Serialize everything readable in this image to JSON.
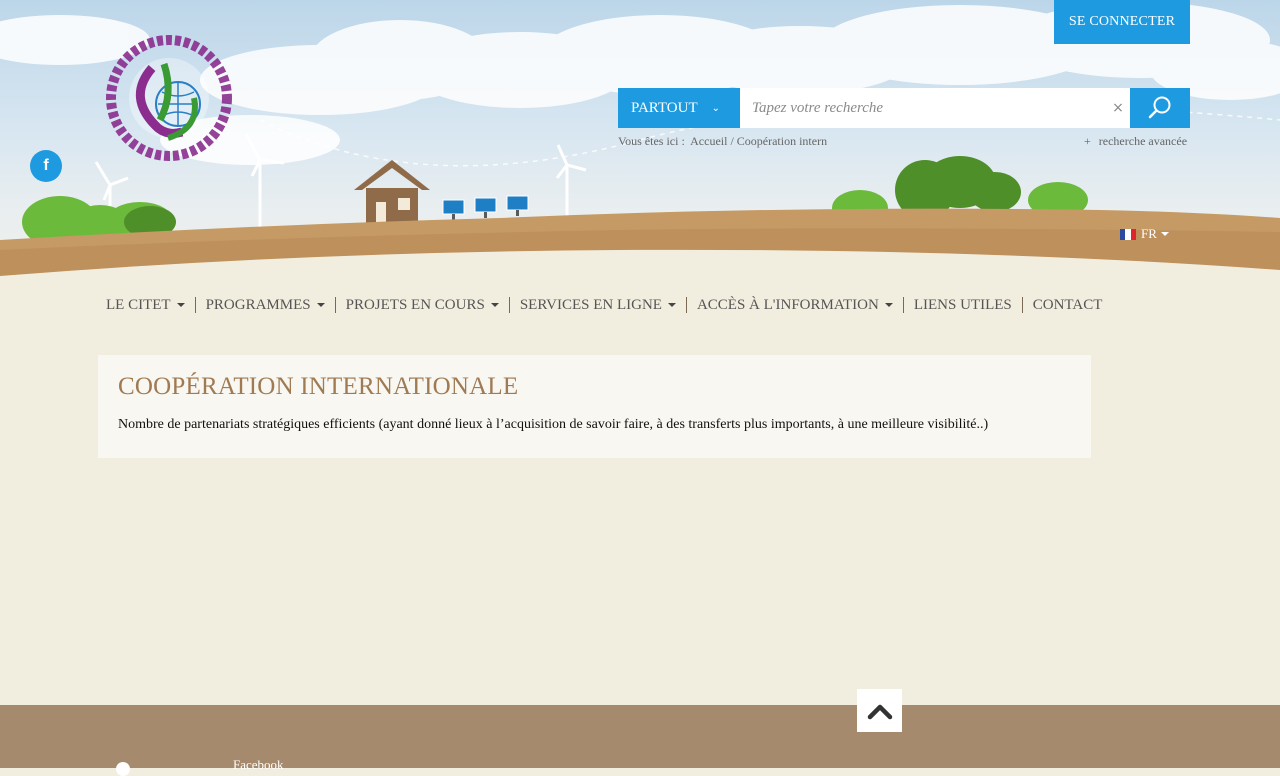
{
  "header": {
    "login_label": "SE CONNECTER",
    "facebook_icon": "f"
  },
  "search": {
    "scope_label": "PARTOUT",
    "placeholder": "Tapez votre recherche",
    "value": "",
    "clear_symbol": "×"
  },
  "breadcrumb": {
    "prefix": "Vous êtes ici :",
    "items": [
      "Accueil",
      "Coopération intern"
    ],
    "separator": "/"
  },
  "advanced_search": {
    "plus": "+",
    "label": "recherche avancée"
  },
  "language": {
    "current": "FR",
    "flag_colors": [
      "#2b4aa0",
      "#ffffff",
      "#e1242b"
    ]
  },
  "nav": {
    "items": [
      {
        "label": "LE CITET",
        "dropdown": true
      },
      {
        "label": "PROGRAMMES",
        "dropdown": true
      },
      {
        "label": "PROJETS EN COURS",
        "dropdown": true
      },
      {
        "label": "SERVICES EN LIGNE",
        "dropdown": true
      },
      {
        "label": "ACCÈS À L'INFORMATION",
        "dropdown": true
      },
      {
        "label": "LIENS UTILES",
        "dropdown": false
      },
      {
        "label": "CONTACT",
        "dropdown": false
      }
    ]
  },
  "content": {
    "title": "COOPÉRATION INTERNATIONALE",
    "text": "Nombre de partenariats stratégiques efficients (ayant donné lieux à l’acquisition de savoir faire, à des transferts plus importants, à une meilleure visibilité..)"
  },
  "footer": {
    "link_label": "Facebook"
  },
  "colors": {
    "accent": "#1e9be0",
    "title": "#a07a52",
    "background": "#f2eedf",
    "footer": "#a58a6e"
  },
  "icons": {
    "search": "search-icon",
    "facebook": "facebook-icon",
    "to_top": "chevron-up-icon",
    "scope": "chevron-down-icon"
  }
}
